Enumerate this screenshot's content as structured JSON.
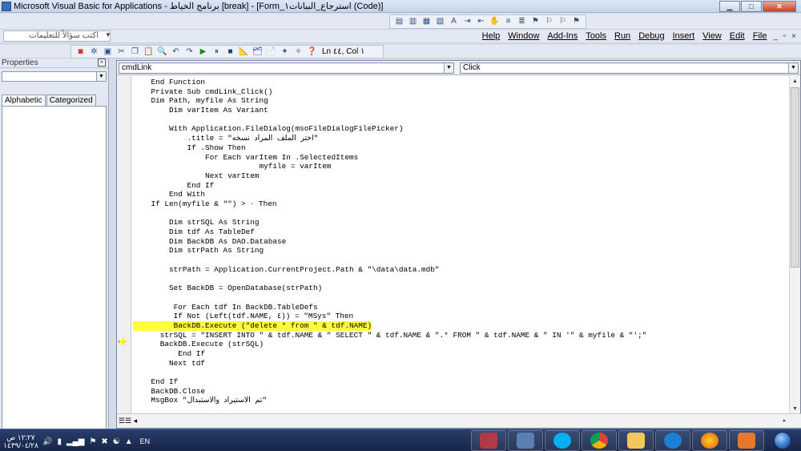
{
  "window": {
    "title": "Microsoft Visual Basic for Applications - برنامج الخياط [break] - [Form_استرجاع_البيانات١ (Code)]",
    "minimize": "▁",
    "maximize": "□",
    "close": "✕"
  },
  "menubar": {
    "help_placeholder": "اكتب سؤالاً للتعليمات",
    "items": [
      "Help",
      "Window",
      "Add-Ins",
      "Tools",
      "Run",
      "Debug",
      "Insert",
      "View",
      "Edit",
      "File"
    ],
    "window_controls": "_ ▫ ×"
  },
  "toolbar": {
    "position_label": "Ln ٤٤, Col ١"
  },
  "properties": {
    "title": "Properties",
    "close": "×",
    "tabs": [
      "Alphabetic",
      "Categorized"
    ]
  },
  "editor": {
    "object_combo": "cmdLink",
    "procedure_combo": "Click",
    "highlight_index": 26,
    "lines": [
      "    End Function",
      "    Private Sub cmdLink_Click()",
      "    Dim Path, myfile As String",
      "        Dim varItem As Variant",
      "",
      "        With Application.FileDialog(msoFileDialogFilePicker)",
      "            .title = \"اختر الملف المراد نسخه\"",
      "            If .Show Then",
      "                For Each varItem In .SelectedItems",
      "                            myfile = varItem",
      "                Next varItem",
      "            End If",
      "        End With",
      "    If Len(myfile & \"\") > ٠ Then",
      "",
      "        Dim strSQL As String",
      "        Dim tdf As TableDef",
      "        Dim BackDB As DAO.Database",
      "        Dim strPath As String",
      "",
      "        strPath = Application.CurrentProject.Path & \"\\data\\data.mdb\"",
      "",
      "        Set BackDB = OpenDatabase(strPath)",
      "",
      "         For Each tdf In BackDB.TableDefs",
      "         If Not (Left(tdf.NAME, ٤)) = \"MSys\" Then",
      "         BackDB.Execute (\"delete * from \" & tdf.NAME)",
      "      strSQL = \"INSERT INTO \" & tdf.NAME & \" SELECT \" & tdf.NAME & \".* FROM \" & tdf.NAME & \" IN '\" & myfile & \"';\"",
      "      BackDB.Execute (strSQL)",
      "          End If",
      "        Next tdf",
      "",
      "    End If",
      "    BackDB.Close",
      "    MsgBox \"تم الاستيراد والاستبدال\""
    ]
  },
  "taskbar": {
    "time": "١٢:٢٧ ص",
    "date": "١٤٣٩/٠٤/٢٨",
    "lang": "EN"
  }
}
